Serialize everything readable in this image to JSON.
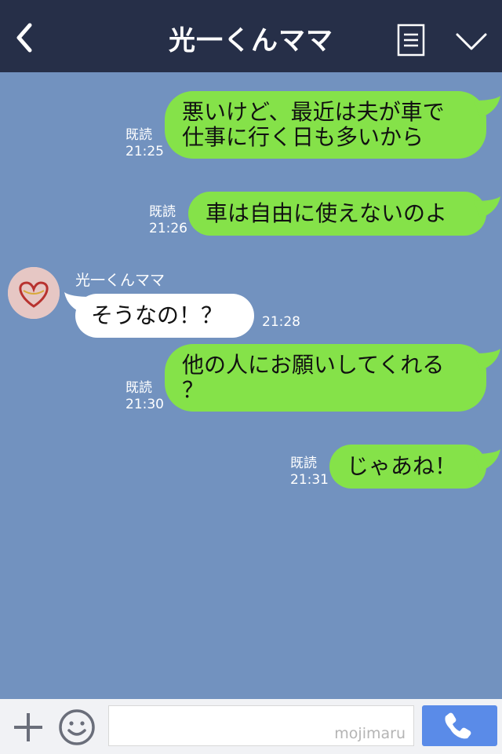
{
  "header": {
    "title": "光一くんママ",
    "back_icon": "chevron-left-icon",
    "menu_icon": "list-icon",
    "dropdown_icon": "chevron-down-icon"
  },
  "messages": [
    {
      "direction": "out",
      "lines": [
        "悪いけど、最近は夫が車で",
        "仕事に行く日も多いから"
      ],
      "read": "既読",
      "time": "21:25"
    },
    {
      "direction": "out",
      "lines": [
        "車は自由に使えないのよ"
      ],
      "read": "既読",
      "time": "21:26"
    },
    {
      "direction": "in",
      "sender": "光一くんママ",
      "lines": [
        "そうなの！？"
      ],
      "time": "21:28"
    },
    {
      "direction": "out",
      "lines": [
        "他の人にお願いしてくれる",
        "？"
      ],
      "read": "既読",
      "time": "21:30"
    },
    {
      "direction": "out",
      "lines": [
        "じゃあね！"
      ],
      "read": "既読",
      "time": "21:31"
    }
  ],
  "input_bar": {
    "plus_icon": "plus-icon",
    "emoji_icon": "smiley-icon",
    "call_icon": "phone-icon",
    "watermark": "mojimaru"
  },
  "colors": {
    "background": "#7292bf",
    "header": "#262f48",
    "outgoing_bubble": "#85e249",
    "incoming_bubble": "#ffffff",
    "call_button": "#5a8be8"
  }
}
